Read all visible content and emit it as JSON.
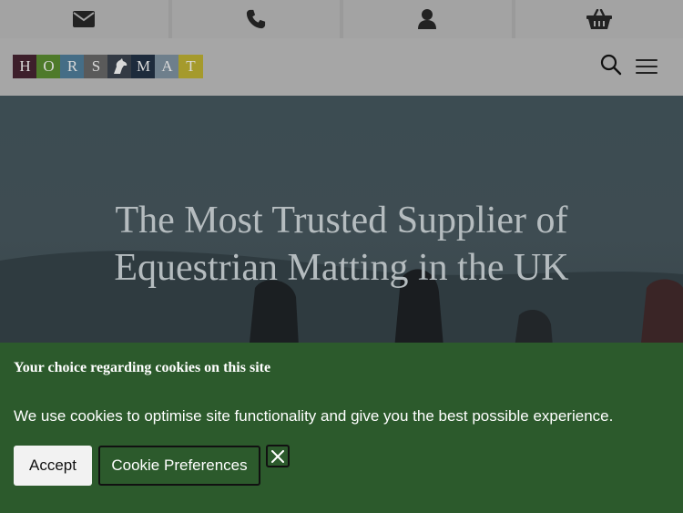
{
  "topbar": {
    "items": [
      {
        "icon": "envelope-icon"
      },
      {
        "icon": "phone-icon"
      },
      {
        "icon": "user-icon"
      },
      {
        "icon": "basket-icon"
      }
    ]
  },
  "header": {
    "logo": {
      "letters": [
        "H",
        "O",
        "R",
        "S",
        "",
        "M",
        "A",
        "T"
      ],
      "colors": [
        "#3d1f2b",
        "#4e7a2a",
        "#456d86",
        "#5a5a5a",
        "#333a44",
        "#1d2b3c",
        "#6e7f8c",
        "#a59a2c"
      ]
    },
    "search_icon": "search-icon",
    "menu_icon": "hamburger-menu-icon"
  },
  "hero": {
    "heading": "The Most Trusted Supplier of Equestrian Matting in the UK"
  },
  "cookie": {
    "title": "Your choice regarding cookies on this site",
    "text": "We use cookies to optimise site functionality and give you the best possible experience.",
    "accept_label": "Accept",
    "preferences_label": "Cookie Preferences",
    "close_icon": "close-icon",
    "background": "#2c5a2c"
  }
}
